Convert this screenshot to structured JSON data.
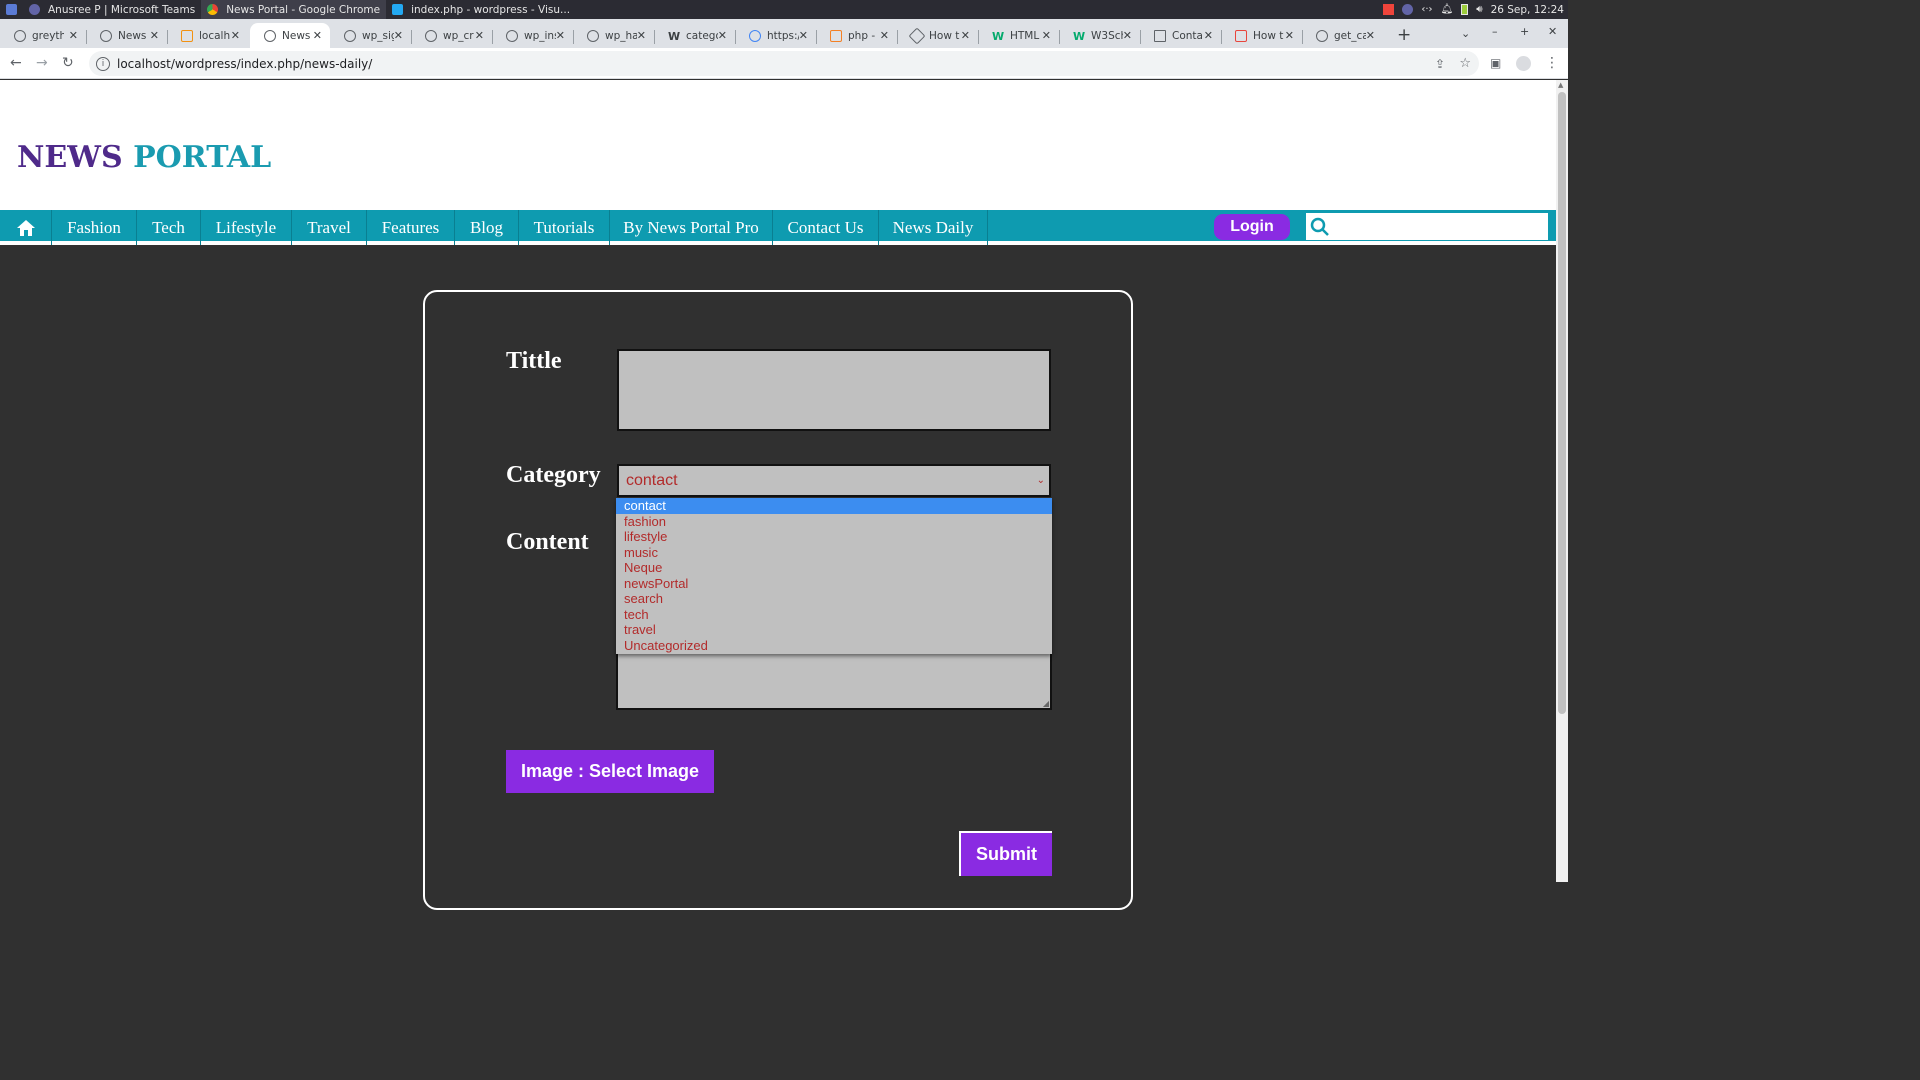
{
  "taskbar": {
    "windows": [
      {
        "label": "Anusree P | Microsoft Teams",
        "icon": "teams-icon"
      },
      {
        "label": "News Portal - Google Chrome",
        "icon": "chrome-icon"
      },
      {
        "label": "index.php - wordpress - Visu...",
        "icon": "vscode-icon"
      }
    ],
    "clock": "26 Sep, 12:24"
  },
  "tabs": [
    {
      "label": "greyth"
    },
    {
      "label": "News"
    },
    {
      "label": "localh"
    },
    {
      "label": "News"
    },
    {
      "label": "wp_sig"
    },
    {
      "label": "wp_cr"
    },
    {
      "label": "wp_ins"
    },
    {
      "label": "wp_ha"
    },
    {
      "label": "catego"
    },
    {
      "label": "https:/"
    },
    {
      "label": "php -"
    },
    {
      "label": "How t"
    },
    {
      "label": "HTML"
    },
    {
      "label": "W3Sch"
    },
    {
      "label": "Conta"
    },
    {
      "label": "How t"
    },
    {
      "label": "get_ca"
    }
  ],
  "address_bar": {
    "url": "localhost/wordpress/index.php/news-daily/"
  },
  "site": {
    "brand_part1": "NEWS",
    "brand_part2": "PORTAL",
    "nav": [
      "Fashion",
      "Tech",
      "Lifestyle",
      "Travel",
      "Features",
      "Blog",
      "Tutorials",
      "By News Portal Pro",
      "Contact Us",
      "News Daily"
    ],
    "login": "Login"
  },
  "form": {
    "title_label": "Tittle",
    "category_label": "Category",
    "content_label": "Content",
    "category_value": "contact",
    "category_options": [
      "contact",
      "fashion",
      "lifestyle",
      "music",
      "Neque",
      "newsPortal",
      "search",
      "tech",
      "travel",
      "Uncategorized"
    ],
    "image_button": "Image : Select Image",
    "submit": "Submit"
  },
  "colors": {
    "brand_purple": "#4f2a8a",
    "brand_teal": "#1a9bb0",
    "nav_bg": "#0e9bb0",
    "button_purple": "#8a2be2",
    "option_text": "#b22b2b",
    "page_bg": "#303030"
  }
}
